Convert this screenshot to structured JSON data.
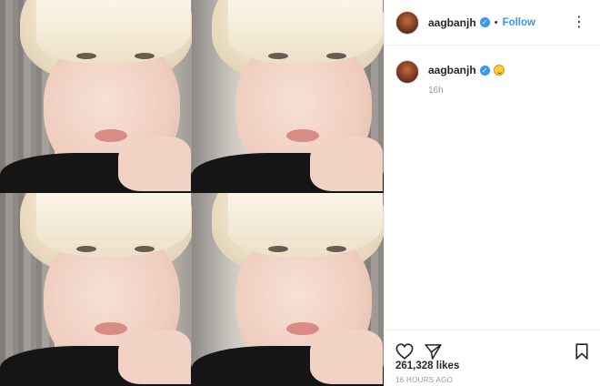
{
  "header": {
    "username": "aagbanjh",
    "verified_glyph": "✓",
    "separator": "•",
    "follow_label": "Follow",
    "more_icon": "⋮"
  },
  "caption": {
    "username": "aagbanjh",
    "verified_glyph": "✓",
    "emoji": "smiling-face-emoji",
    "time": "16h"
  },
  "stats": {
    "likes": "261,328 likes",
    "posted": "16 HOURS AGO"
  },
  "colors": {
    "accent": "#3897f0",
    "text": "#262626",
    "muted": "#999999"
  }
}
